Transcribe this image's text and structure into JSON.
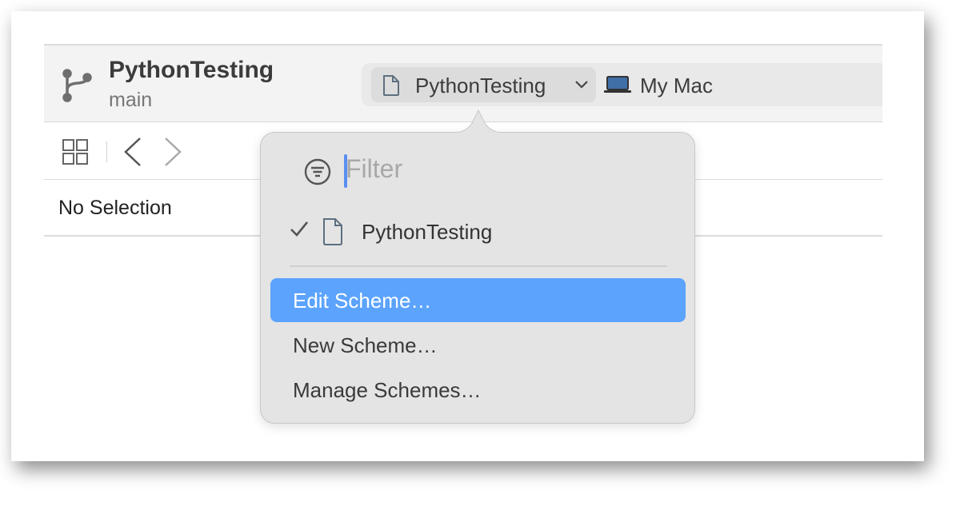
{
  "toolbar": {
    "project_title": "PythonTesting",
    "branch": "main",
    "scheme": {
      "name": "PythonTesting",
      "icon": "document-icon"
    },
    "destination": {
      "name": "My Mac",
      "icon": "laptop-icon"
    }
  },
  "navigator": {
    "status": "No Selection"
  },
  "scheme_menu": {
    "filter_placeholder": "Filter",
    "schemes": [
      {
        "label": "PythonTesting",
        "checked": true
      }
    ],
    "actions": [
      {
        "label": "Edit Scheme…",
        "highlighted": true
      },
      {
        "label": "New Scheme…",
        "highlighted": false
      },
      {
        "label": "Manage Schemes…",
        "highlighted": false
      }
    ]
  },
  "colors": {
    "highlight": "#5ba3fd",
    "caret": "#5a8ef0"
  }
}
